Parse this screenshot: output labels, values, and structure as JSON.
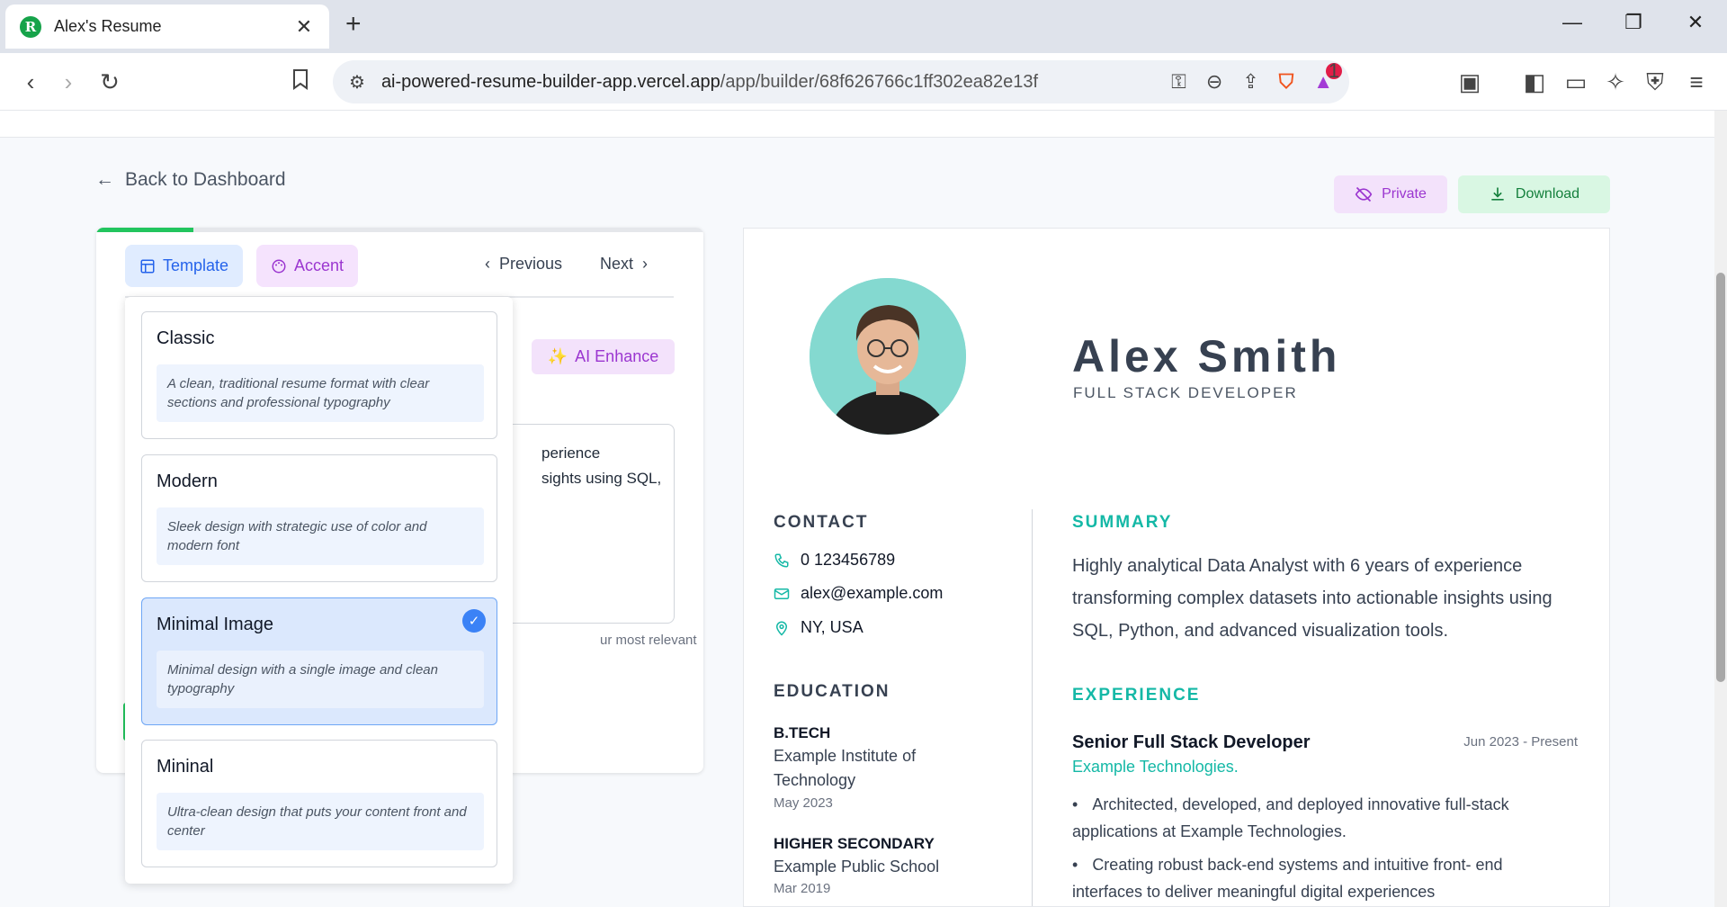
{
  "browser": {
    "tab_title": "Alex's Resume",
    "favicon_letter": "R",
    "url_site": "ai-powered-resume-builder-app.vercel.app",
    "url_path": "/app/builder/68f626766c1ff302ea82e13f",
    "rewards_badge": "1"
  },
  "page": {
    "back_label": "Back to Dashboard",
    "private_label": "Private",
    "download_label": "Download"
  },
  "editor": {
    "progress": 0.16,
    "tab_template": "Template",
    "tab_accent": "Accent",
    "prev_label": "Previous",
    "next_label": "Next",
    "ai_enhance_label": "AI Enhance",
    "textarea_line1": "perience",
    "textarea_line2": "sights using SQL,",
    "hint_fragment": "ur most relevant"
  },
  "templates": [
    {
      "name": "Classic",
      "description": "A clean, traditional resume format with clear sections and professional typography",
      "selected": false
    },
    {
      "name": "Modern",
      "description": "Sleek design with strategic use of color and modern font",
      "selected": false
    },
    {
      "name": "Minimal Image",
      "description": "Minimal design with a single image and clean typography",
      "selected": true
    },
    {
      "name": "Mininal",
      "description": "Ultra-clean design that puts your content front and center",
      "selected": false
    }
  ],
  "resume": {
    "name": "Alex Smith",
    "role": "FULL STACK DEVELOPER",
    "contact_heading": "CONTACT",
    "phone": "0 123456789",
    "email": "alex@example.com",
    "location": "NY, USA",
    "education_heading": "EDUCATION",
    "education": [
      {
        "degree": "B.TECH",
        "school": "Example Institute of Technology",
        "date": "May 2023"
      },
      {
        "degree": "HIGHER SECONDARY",
        "school": "Example Public School",
        "date": "Mar 2019"
      }
    ],
    "summary_heading": "SUMMARY",
    "summary": "Highly analytical Data Analyst with 6 years of experience transforming complex datasets into actionable insights using SQL, Python, and advanced visualization tools.",
    "experience_heading": "EXPERIENCE",
    "job": {
      "title": "Senior Full Stack Developer",
      "date": "Jun 2023 - Present",
      "company": "Example Technologies.",
      "bullets": [
        "Architected, developed, and deployed innovative full-stack applications at Example Technologies.",
        "Creating robust back-end systems and intuitive front- end interfaces to deliver meaningful digital experiences"
      ]
    }
  },
  "colors": {
    "accent_teal": "#14b8a6",
    "template_blue": "#2563eb",
    "accent_purple": "#9b36d0",
    "download_green": "#15803d"
  }
}
